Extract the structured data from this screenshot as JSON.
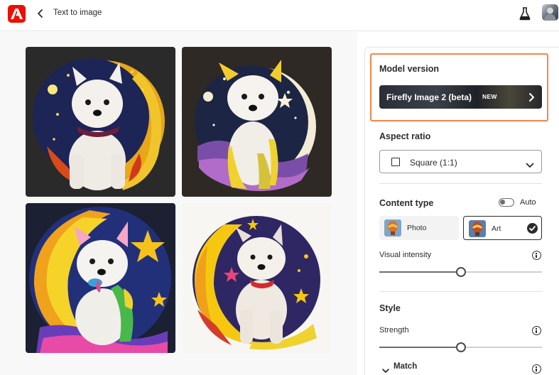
{
  "header": {
    "app_logo": "adobe-logo",
    "back_icon": "chevron-left-icon",
    "title": "Text to image",
    "labs_icon": "flask-icon",
    "avatar": "user-avatar"
  },
  "gallery": {
    "images": [
      {
        "subject": "westie-moon-art-1",
        "background": "#2a2a2a"
      },
      {
        "subject": "westie-moon-art-2",
        "background": "#2e2924"
      },
      {
        "subject": "westie-moon-art-3",
        "background": "#1b2033"
      },
      {
        "subject": "westie-moon-art-4",
        "background": "#f7f6f2"
      }
    ]
  },
  "panel": {
    "model_version": {
      "title": "Model version",
      "selected": "Firefly Image 2 (beta)",
      "badge": "NEW",
      "highlight_color": "#f3874b"
    },
    "aspect_ratio": {
      "title": "Aspect ratio",
      "selected": "Square (1:1)",
      "icon": "square-icon"
    },
    "content_type": {
      "title": "Content type",
      "auto_label": "Auto",
      "auto_on": false,
      "options": [
        {
          "label": "Photo",
          "selected": false
        },
        {
          "label": "Art",
          "selected": true
        }
      ]
    },
    "visual_intensity": {
      "label": "Visual intensity",
      "value_fraction": 0.5
    },
    "style": {
      "title": "Style",
      "strength_label": "Strength",
      "strength_fraction": 0.5,
      "match_label": "Match"
    }
  },
  "colors": {
    "brand": "#eb1000",
    "text": "#2c2c2c",
    "highlight": "#f3874b"
  }
}
